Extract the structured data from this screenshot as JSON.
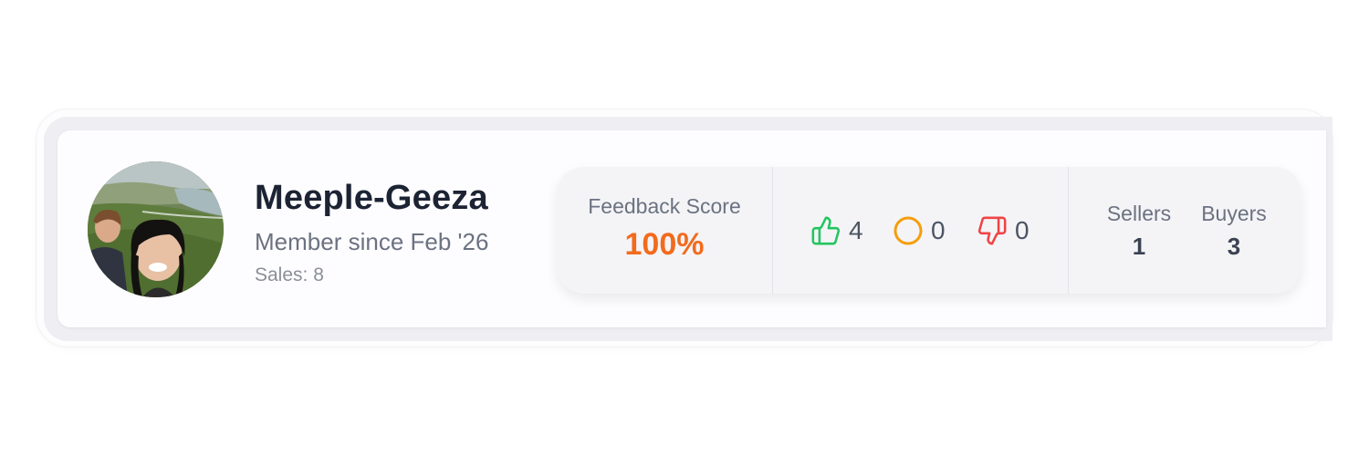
{
  "profile": {
    "username": "Meeple-Geeza",
    "member_since": "Member since Feb '26",
    "sales": "Sales: 8",
    "avatar_icon": "profile-photo"
  },
  "stats": {
    "feedback_label": "Feedback Score",
    "feedback_score": "100%",
    "positive": {
      "icon": "thumbs-up-icon",
      "count": "4",
      "color": "#22c55e"
    },
    "neutral": {
      "icon": "neutral-circle-icon",
      "count": "0",
      "color": "#f59e0b"
    },
    "negative": {
      "icon": "thumbs-down-icon",
      "count": "0",
      "color": "#ef4444"
    },
    "sellers_label": "Sellers",
    "sellers_count": "1",
    "buyers_label": "Buyers",
    "buyers_count": "3"
  },
  "colors": {
    "accent": "#f26b1d",
    "title_text": "#1c2333"
  }
}
